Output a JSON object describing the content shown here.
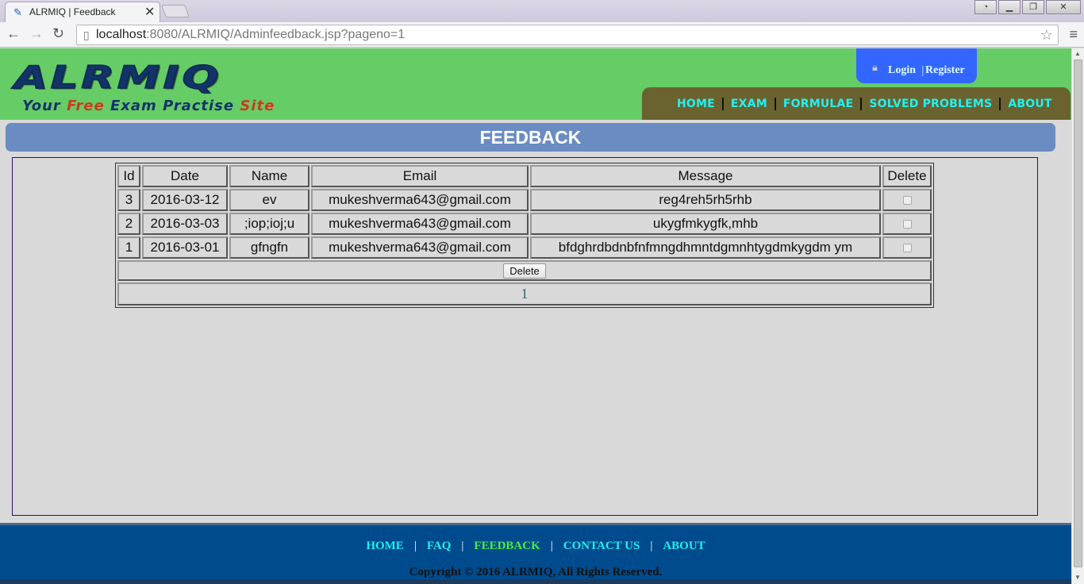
{
  "browser": {
    "tab_title": "ALRMIQ | Feedback",
    "tab_close": "✕",
    "url_host": "localhost",
    "url_rest": ":8080/ALRMIQ/Adminfeedback.jsp?pageno=1"
  },
  "header": {
    "logo_text": "ALRMIQ",
    "tagline": [
      "Your",
      "Free",
      "Exam",
      "Practise",
      "Site"
    ],
    "login_label": "Login",
    "register_label": "Register",
    "nav": [
      "HOME",
      "EXAM",
      "FORMULAE",
      "SOLVED PROBLEMS",
      "ABOUT"
    ]
  },
  "banner_title": "FEEDBACK",
  "table": {
    "headers": [
      "Id",
      "Date",
      "Name",
      "Email",
      "Message",
      "Delete"
    ],
    "rows": [
      {
        "id": "3",
        "date": "2016-03-12",
        "name": "ev",
        "email": "mukeshverma643@gmail.com",
        "message": "reg4reh5rh5rhb"
      },
      {
        "id": "2",
        "date": "2016-03-03",
        "name": ";iop;ioj;u",
        "email": "mukeshverma643@gmail.com",
        "message": "ukygfmkygfk,mhb"
      },
      {
        "id": "1",
        "date": "2016-03-01",
        "name": "gfngfn",
        "email": "mukeshverma643@gmail.com",
        "message": "bfdghrdbdnbfnfmngdhmntdgmnhtygdmkygdm ym"
      }
    ],
    "delete_button": "Delete",
    "page_number": "1"
  },
  "footer": {
    "nav": [
      "HOME",
      "FAQ",
      "FEEDBACK",
      "CONTACT US",
      "ABOUT"
    ],
    "active": "FEEDBACK",
    "copyright": "Copyright © 2016 ALRMIQ, All Rights Reserved."
  },
  "colors": {
    "header_bg": "#66cc66",
    "banner_bg": "#6b8cc2",
    "footer_bg": "#004b8d",
    "nav_link": "#22f0f0",
    "footer_active": "#44f244"
  }
}
